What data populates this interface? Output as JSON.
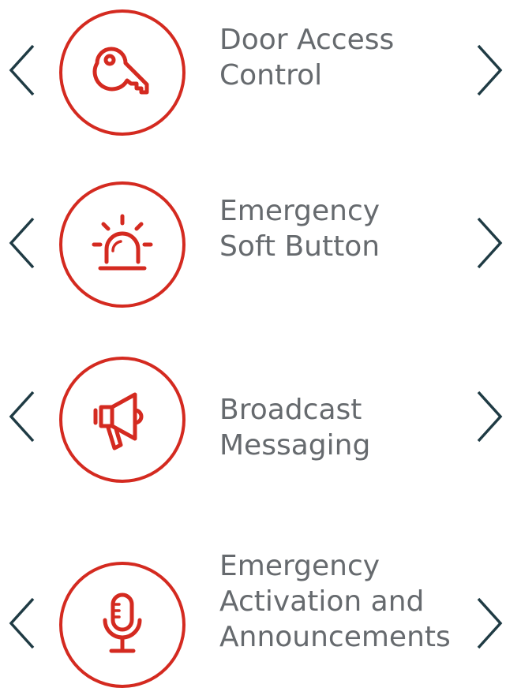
{
  "colors": {
    "accent": "#d42a20",
    "chevron": "#1f3b44",
    "text": "#666a6e"
  },
  "items": [
    {
      "icon": "key-icon",
      "lines": [
        "Door Access",
        "Control"
      ]
    },
    {
      "icon": "siren-icon",
      "lines": [
        "Emergency",
        "Soft Button"
      ]
    },
    {
      "icon": "megaphone-icon",
      "lines": [
        "Broadcast",
        "Messaging"
      ]
    },
    {
      "icon": "microphone-icon",
      "lines": [
        "Emergency",
        "Activation and",
        "Announcements"
      ]
    }
  ]
}
